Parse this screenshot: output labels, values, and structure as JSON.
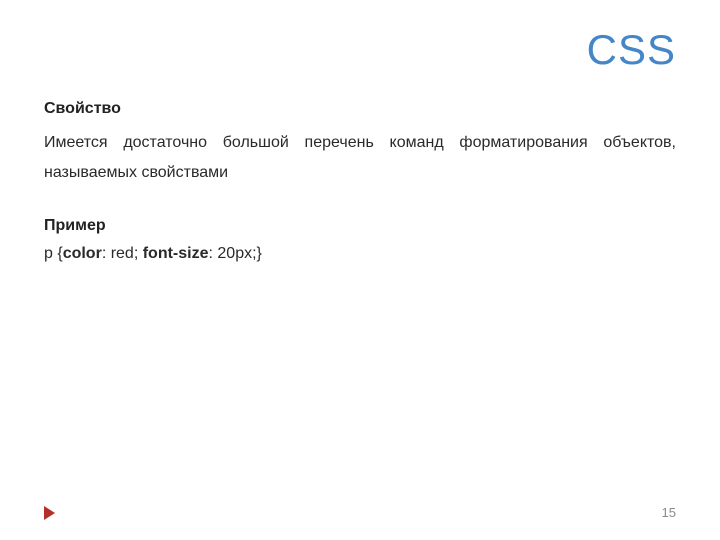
{
  "slide": {
    "title": "CSS",
    "section_heading": "Свойство",
    "body_text": "Имеется достаточно большой перечень команд форматирования объектов, называемых свойствами",
    "example_heading": "Пример",
    "code": {
      "selector_open": "p {",
      "prop1": "color",
      "sep1": ": red; ",
      "prop2": "font-size",
      "sep2": ": 20px;}"
    },
    "page_number": "15"
  }
}
